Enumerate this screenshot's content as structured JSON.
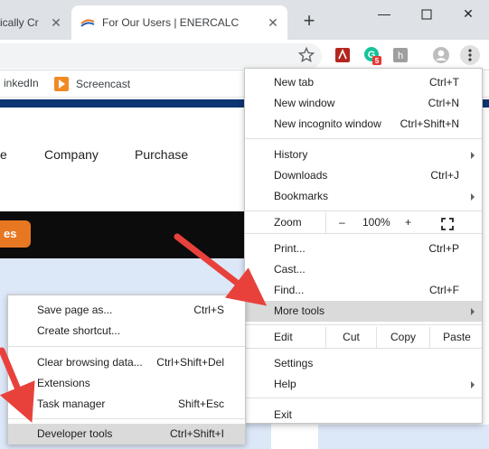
{
  "tabs": [
    {
      "title": "ically Cr",
      "active": false
    },
    {
      "title": "For Our Users | ENERCALC",
      "active": true
    }
  ],
  "window_controls": {
    "minimize": "—",
    "maximize": "☐",
    "close": "✕"
  },
  "new_tab_symbol": "+",
  "toolbar": {
    "extension_badge": "5"
  },
  "bookmarks": [
    {
      "label": "inkedIn"
    },
    {
      "label": "Screencast"
    }
  ],
  "page": {
    "nav": [
      "e",
      "Company",
      "Purchase"
    ],
    "orange_button": "es"
  },
  "main_menu": {
    "new_tab": {
      "label": "New tab",
      "shortcut": "Ctrl+T"
    },
    "new_window": {
      "label": "New window",
      "shortcut": "Ctrl+N"
    },
    "new_incognito": {
      "label": "New incognito window",
      "shortcut": "Ctrl+Shift+N"
    },
    "history": {
      "label": "History"
    },
    "downloads": {
      "label": "Downloads",
      "shortcut": "Ctrl+J"
    },
    "bookmarks": {
      "label": "Bookmarks"
    },
    "zoom": {
      "label": "Zoom",
      "minus": "–",
      "value": "100%",
      "plus": "+"
    },
    "print": {
      "label": "Print...",
      "shortcut": "Ctrl+P"
    },
    "cast": {
      "label": "Cast..."
    },
    "find": {
      "label": "Find...",
      "shortcut": "Ctrl+F"
    },
    "more_tools": {
      "label": "More tools"
    },
    "edit": {
      "label": "Edit",
      "cut": "Cut",
      "copy": "Copy",
      "paste": "Paste"
    },
    "settings": {
      "label": "Settings"
    },
    "help": {
      "label": "Help"
    },
    "exit": {
      "label": "Exit"
    }
  },
  "sub_menu": {
    "save_page": {
      "label": "Save page as...",
      "shortcut": "Ctrl+S"
    },
    "create_shortcut": {
      "label": "Create shortcut..."
    },
    "clear_browsing": {
      "label": "Clear browsing data...",
      "shortcut": "Ctrl+Shift+Del"
    },
    "extensions": {
      "label": "Extensions"
    },
    "task_manager": {
      "label": "Task manager",
      "shortcut": "Shift+Esc"
    },
    "developer_tools": {
      "label": "Developer tools",
      "shortcut": "Ctrl+Shift+I"
    }
  },
  "colors": {
    "accent_arrow": "#e8413b",
    "highlight": "#dadada",
    "orange": "#e87722",
    "navy": "#0d3572"
  }
}
